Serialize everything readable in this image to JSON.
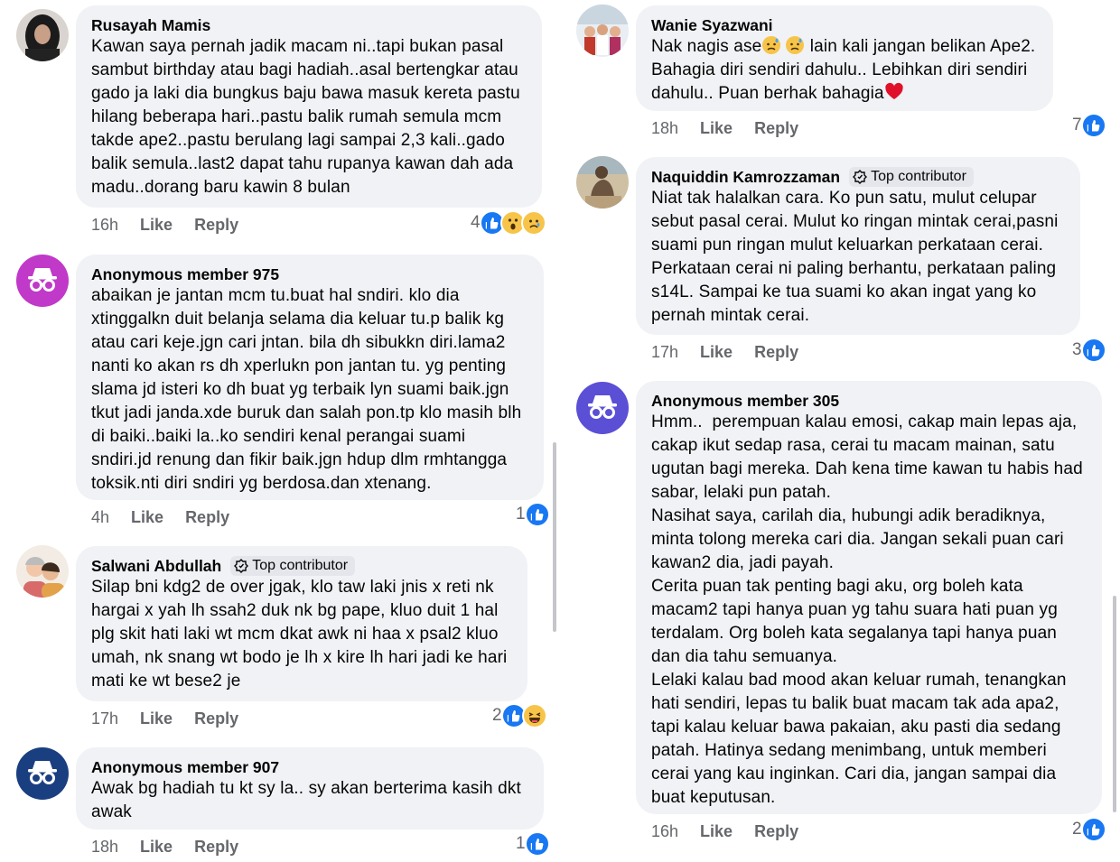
{
  "left_comments": [
    {
      "author": "Rusayah Mamis",
      "avatar": "hijab-woman-photo",
      "text": "Kawan saya pernah jadik macam ni..tapi bukan pasal\nsambut birthday atau bagi hadiah..asal bertengkar atau\ngado ja laki dia bungkus baju bawa masuk kereta pastu\nhilang beberapa hari..pastu balik rumah semula mcm\ntakde ape2..pastu berulang lagi sampai 2,3 kali..gado\nbalik semula..last2 dapat tahu rupanya kawan dah ada\nmadu..dorang baru kawin 8 bulan",
      "time": "16h",
      "like": "Like",
      "reply": "Reply",
      "reaction_count": "4",
      "reactions": [
        "like-icon",
        "wow-icon",
        "sad-icon"
      ]
    },
    {
      "author": "Anonymous member 975",
      "avatar": "anonymous-icon",
      "avatar_color": "#c039c8",
      "text": "abaikan je jantan mcm tu.buat hal sndiri. klo dia\nxtinggalkn duit belanja selama dia keluar tu.p balik kg\natau cari keje.jgn cari jntan. bila dh sibukkn diri.lama2\nnanti ko akan rs dh xperlukn pon jantan tu. yg penting\nslama jd isteri ko dh buat yg terbaik lyn suami baik.jgn\ntkut jadi janda.xde buruk dan salah pon.tp klo masih blh\ndi baiki..baiki la..ko sendiri kenal perangai suami\nsndiri.jd renung dan fikir baik.jgn hdup dlm rmhtangga\ntoksik.nti diri sndiri yg berdosa.dan xtenang.",
      "time": "4h",
      "like": "Like",
      "reply": "Reply",
      "reaction_count": "1",
      "reactions": [
        "like-icon"
      ]
    },
    {
      "author": "Salwani Abdullah",
      "badge": "Top contributor",
      "avatar": "cartoon-couple-photo",
      "text": "Silap bni kdg2 de over jgak, klo taw laki jnis x reti nk\nhargai x yah lh ssah2 duk nk bg pape, kluo duit 1 hal\nplg skit hati laki wt mcm dkat awk ni haa x psal2 kluo\numah, nk snang wt bodo je lh x kire lh hari jadi ke hari\nmati ke wt bese2 je",
      "time": "17h",
      "like": "Like",
      "reply": "Reply",
      "reaction_count": "2",
      "reactions": [
        "like-icon",
        "haha-icon"
      ]
    },
    {
      "author": "Anonymous member 907",
      "avatar": "anonymous-icon",
      "avatar_color": "#1a3f80",
      "text": "Awak bg hadiah tu kt sy la.. sy akan berterima kasih dkt\nawak",
      "time": "18h",
      "like": "Like",
      "reply": "Reply",
      "reaction_count": "1",
      "reactions": [
        "like-icon"
      ]
    }
  ],
  "right_comments": [
    {
      "author": "Wanie Syazwani",
      "avatar": "group-photo",
      "text_parts": [
        "Nak nagis ase",
        " lain kali jangan belikan Ape2.\nBahagia diri sendiri dahulu.. Lebihkan diri sendiri\ndahulu.. Puan berhak bahagia"
      ],
      "time": "18h",
      "like": "Like",
      "reply": "Reply",
      "reaction_count": "7",
      "reactions": [
        "like-icon"
      ]
    },
    {
      "author": "Naquiddin Kamrozzaman",
      "badge": "Top contributor",
      "avatar": "beach-man-photo",
      "text": "Niat tak halalkan cara. Ko pun satu, mulut celupar\nsebut pasal cerai. Mulut ko ringan mintak cerai,pasni\nsuami pun ringan mulut keluarkan perkataan cerai.\nPerkataan cerai ni paling berhantu, perkataan paling\ns14L. Sampai ke tua suami ko akan ingat yang ko\npernah mintak cerai.",
      "time": "17h",
      "like": "Like",
      "reply": "Reply",
      "reaction_count": "3",
      "reactions": [
        "like-icon"
      ]
    },
    {
      "author": "Anonymous member 305",
      "avatar": "anonymous-icon",
      "avatar_color": "#5b4fd6",
      "text": "Hmm..  perempuan kalau emosi, cakap main lepas aja,\ncakap ikut sedap rasa, cerai tu macam mainan, satu\nugutan bagi mereka. Dah kena time kawan tu habis had\nsabar, lelaki pun patah.\nNasihat saya, carilah dia, hubungi adik beradiknya,\nminta tolong mereka cari dia. Jangan sekali puan cari\nkawan2 dia, jadi payah.\nCerita puan tak penting bagi aku, org boleh kata\nmacam2 tapi hanya puan yg tahu suara hati puan yg\nterdalam. Org boleh kata segalanya tapi hanya puan\ndan dia tahu semuanya.\nLelaki kalau bad mood akan keluar rumah, tenangkan\nhati sendiri, lepas tu balik buat macam tak ada apa2,\ntapi kalau keluar bawa pakaian, aku pasti dia sedang\npatah. Hatinya sedang menimbang, untuk memberi\ncerai yang kau inginkan. Cari dia, jangan sampai dia\nbuat keputusan.",
      "time": "16h",
      "like": "Like",
      "reply": "Reply",
      "reaction_count": "2",
      "reactions": [
        "like-icon"
      ]
    }
  ],
  "colors": {
    "like_blue": "#1877f2",
    "bubble_bg": "#f0f2f5",
    "secondary_text": "#65676b"
  }
}
